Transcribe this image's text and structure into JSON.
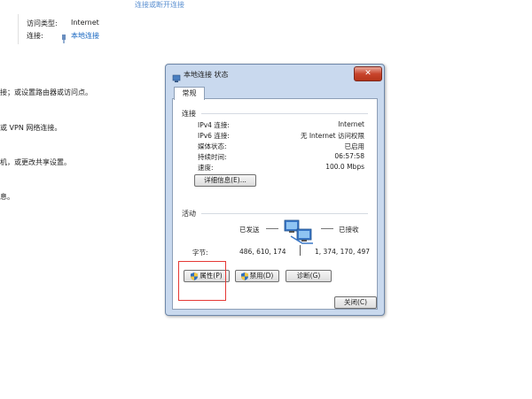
{
  "background": {
    "top_link": "连接或断开连接",
    "access_type_label": "访问类型:",
    "access_type_value": "Internet",
    "connection_label": "连接:",
    "connection_value": "本地连接",
    "lines": [
      "接；或设置路由器或访问点。",
      "或 VPN 网络连接。",
      "机，或更改共享设置。",
      "息。"
    ]
  },
  "dialog": {
    "title": "本地连接 状态",
    "close_label": "✕",
    "tab": "常规",
    "connection_group": "连接",
    "rows": [
      {
        "label": "IPv4 连接:",
        "value": "Internet"
      },
      {
        "label": "IPv6 连接:",
        "value": "无 Internet 访问权限"
      },
      {
        "label": "媒体状态:",
        "value": "已启用"
      },
      {
        "label": "持续时间:",
        "value": "06:57:58"
      },
      {
        "label": "速度:",
        "value": "100.0 Mbps"
      }
    ],
    "details_button": "详细信息(E)...",
    "activity_group": "活动",
    "sent_label": "已发送",
    "received_label": "已接收",
    "bytes_label": "字节:",
    "bytes_sent": "486, 610, 174",
    "bytes_received": "1, 374, 170, 497",
    "properties_button": "属性(P)",
    "disable_button": "禁用(D)",
    "diagnose_button": "诊断(G)",
    "close_button": "关闭(C)"
  },
  "colors": {
    "dialog_frame": "#c9d9ee",
    "highlight": "#e53935",
    "link": "#1565c0"
  }
}
